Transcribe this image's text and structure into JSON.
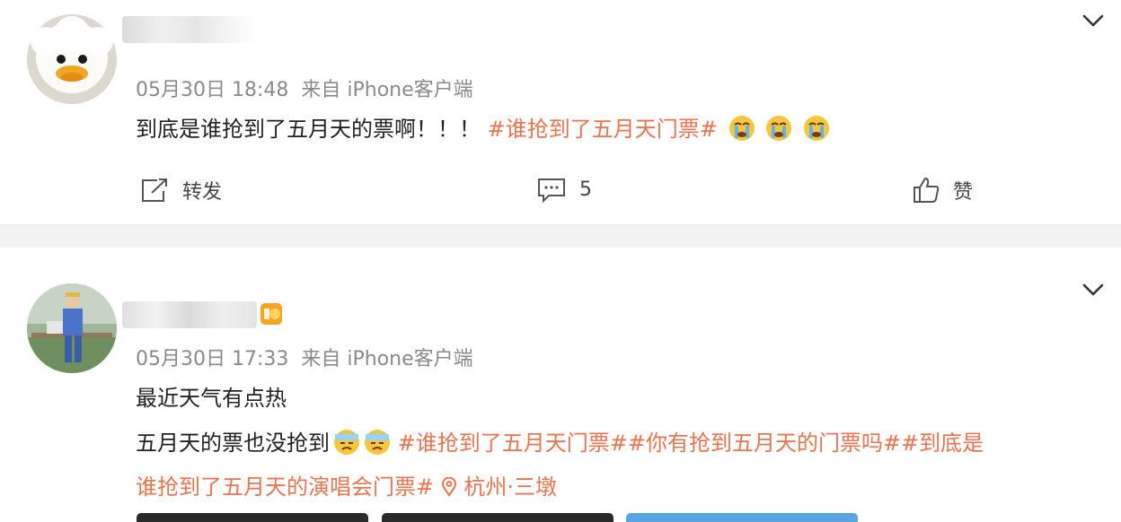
{
  "posts": [
    {
      "meta_date": "05月30日 18:48",
      "meta_source": "来自 iPhone客户端",
      "line1_text": "到底是谁抢到了五月天的票啊！！！",
      "line1_topic": "#谁抢到了五月天门票#",
      "actions": {
        "repost_label": "转发",
        "comment_count": "5",
        "like_label": "赞"
      }
    },
    {
      "meta_date": "05月30日 17:33",
      "meta_source": "来自 iPhone客户端",
      "line1_text": "最近天气有点热",
      "line2_text": "五月天的票也没抢到",
      "line2_topics": "#谁抢到了五月天门票##你有抢到五月天的门票吗##到底是",
      "line3_topic": "谁抢到了五月天的演唱会门票#",
      "location": "杭州·三墩"
    }
  ],
  "colors": {
    "topic": "#eb7350",
    "meta": "#8a8a8a",
    "divider": "#f2f2f3"
  },
  "icons": [
    "chevron-down-icon",
    "repost-icon",
    "comment-icon",
    "like-icon",
    "crying-emoji-icon",
    "sweat-emoji-icon",
    "location-pin-icon"
  ]
}
